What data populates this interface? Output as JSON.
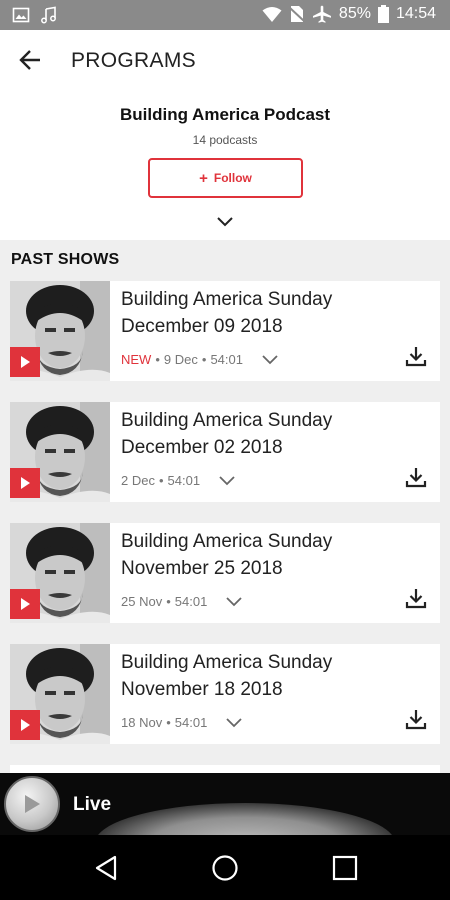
{
  "status_bar": {
    "battery": "85%",
    "time": "14:54",
    "icons": [
      "image-icon",
      "music-icon",
      "wifi-icon",
      "no-sim-icon",
      "airplane-icon",
      "battery-icon"
    ]
  },
  "app_bar": {
    "title": "PROGRAMS",
    "back_icon": "arrow-left-icon"
  },
  "podcast": {
    "title": "Building America Podcast",
    "count": "14 podcasts",
    "follow_label": "Follow",
    "follow_prefix": "+"
  },
  "section_title": "PAST SHOWS",
  "episodes": [
    {
      "title": "Building America Sunday December 09 2018",
      "new_label": "NEW",
      "date": "9 Dec",
      "duration": "54:01"
    },
    {
      "title": "Building America Sunday December 02 2018",
      "new_label": "",
      "date": "2 Dec",
      "duration": "54:01"
    },
    {
      "title": "Building America Sunday November 25 2018",
      "new_label": "",
      "date": "25 Nov",
      "duration": "54:01"
    },
    {
      "title": "Building America Sunday November 18 2018",
      "new_label": "",
      "date": "18 Nov",
      "duration": "54:01"
    }
  ],
  "player": {
    "label": "Live"
  },
  "colors": {
    "accent": "#e0333b",
    "status_bar": "#8a8a8a",
    "background": "#efefef"
  }
}
